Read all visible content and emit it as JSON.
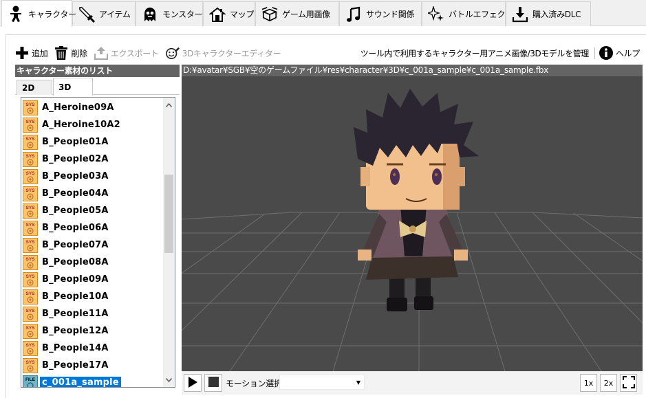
{
  "tabs": [
    {
      "label": "キャラクター",
      "icon": "person-icon",
      "active": true
    },
    {
      "label": "アイテム",
      "icon": "sword-icon",
      "active": false
    },
    {
      "label": "モンスター",
      "icon": "ghost-icon",
      "active": false
    },
    {
      "label": "マップ",
      "icon": "house-icon",
      "active": false
    },
    {
      "label": "ゲーム用画像",
      "icon": "box-icon",
      "active": false
    },
    {
      "label": "サウンド関係",
      "icon": "music-note-icon",
      "active": false
    },
    {
      "label": "バトルエフェクト",
      "icon": "sparkle-icon",
      "active": false
    },
    {
      "label": "購入済みDLC",
      "icon": "download-icon",
      "active": false
    }
  ],
  "toolbar": {
    "add_label": "追加",
    "delete_label": "削除",
    "export_label": "エクスポート",
    "editor_label": "3Dキャラクターエディター",
    "manage_label": "ツール内で利用するキャラクター用アニメ画像/3Dモデルを管理",
    "help_label": "ヘルプ"
  },
  "left_panel": {
    "header": "キャラクター素材のリスト",
    "subtabs": [
      "2D",
      "3D"
    ],
    "active_subtab": "3D",
    "items": [
      {
        "label": "A_Heroine09A",
        "icon": "sys-file-icon"
      },
      {
        "label": "A_Heroine10A2",
        "icon": "sys-file-icon"
      },
      {
        "label": "B_People01A",
        "icon": "sys-file-icon"
      },
      {
        "label": "B_People02A",
        "icon": "sys-file-icon"
      },
      {
        "label": "B_People03A",
        "icon": "sys-file-icon"
      },
      {
        "label": "B_People04A",
        "icon": "sys-file-icon"
      },
      {
        "label": "B_People05A",
        "icon": "sys-file-icon"
      },
      {
        "label": "B_People06A",
        "icon": "sys-file-icon"
      },
      {
        "label": "B_People07A",
        "icon": "sys-file-icon"
      },
      {
        "label": "B_People08A",
        "icon": "sys-file-icon"
      },
      {
        "label": "B_People09A",
        "icon": "sys-file-icon"
      },
      {
        "label": "B_People10A",
        "icon": "sys-file-icon"
      },
      {
        "label": "B_People11A",
        "icon": "sys-file-icon"
      },
      {
        "label": "B_People12A",
        "icon": "sys-file-icon"
      },
      {
        "label": "B_People14A",
        "icon": "sys-file-icon"
      },
      {
        "label": "B_People17A",
        "icon": "sys-file-icon"
      },
      {
        "label": "c_001a_sample",
        "icon": "user-file-icon",
        "selected": true
      }
    ],
    "sys_badge": "SYS",
    "file_badge": "FILE"
  },
  "viewer": {
    "path": "D:¥avatar¥SGB¥空のゲームファイル¥res¥character¥3D¥c_001a_sample¥c_001a_sample.fbx",
    "background_color": "#4a4a4a"
  },
  "controls": {
    "motion_label": "モーション選択",
    "motion_value": "",
    "zoom_1x": "1x",
    "zoom_2x": "2x"
  },
  "colors": {
    "header_bg": "#646464",
    "selection": "#0078d7"
  }
}
